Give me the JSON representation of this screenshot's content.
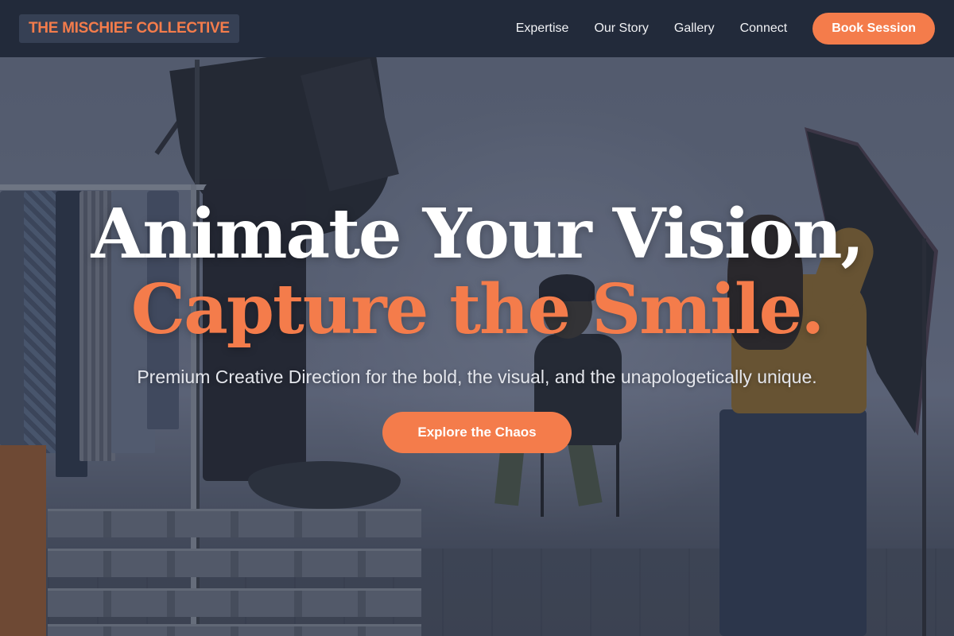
{
  "brand": {
    "name": "THE MISCHIEF COLLECTIVE",
    "accent_color": "#f47c4b",
    "nav_bg_color": "#222a3a"
  },
  "nav": {
    "links": [
      {
        "label": "Expertise"
      },
      {
        "label": "Our Story"
      },
      {
        "label": "Gallery"
      },
      {
        "label": "Connect"
      }
    ],
    "cta_label": "Book Session"
  },
  "hero": {
    "headline_line1": "Animate Your Vision,",
    "headline_line2": "Capture the Smile.",
    "subtitle": "Premium Creative Direction for the bold, the visual, and the unapologetically unique.",
    "cta_label": "Explore the Chaos",
    "background_image": "photo studio scene with clothing rack, softbox lights, seated model and photographer"
  }
}
